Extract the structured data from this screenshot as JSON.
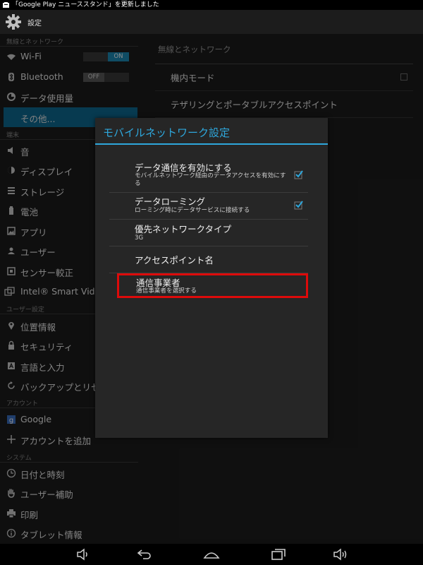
{
  "status_bar": {
    "notification": "「Google Play ニューススタンド」を更新しました"
  },
  "action_bar": {
    "title": "設定"
  },
  "sidebar": {
    "sections": [
      {
        "header": "無線とネットワーク"
      },
      {
        "header": "端末"
      },
      {
        "header": "ユーザー設定"
      },
      {
        "header": "アカウント"
      },
      {
        "header": "システム"
      }
    ],
    "items": [
      {
        "label": "Wi-Fi",
        "icon": "wifi-icon",
        "toggle": "ON"
      },
      {
        "label": "Bluetooth",
        "icon": "bluetooth-icon",
        "toggle": "OFF"
      },
      {
        "label": "データ使用量",
        "icon": "data-usage-icon"
      },
      {
        "label": "その他...",
        "icon": ""
      },
      {
        "label": "音",
        "icon": "sound-icon"
      },
      {
        "label": "ディスプレイ",
        "icon": "display-icon"
      },
      {
        "label": "ストレージ",
        "icon": "storage-icon"
      },
      {
        "label": "電池",
        "icon": "battery-icon"
      },
      {
        "label": "アプリ",
        "icon": "apps-icon"
      },
      {
        "label": "ユーザー",
        "icon": "user-icon"
      },
      {
        "label": "センサー較正",
        "icon": "sensor-icon"
      },
      {
        "label": "Intel® Smart Video",
        "icon": "intel-smart-video-icon"
      },
      {
        "label": "位置情報",
        "icon": "location-icon"
      },
      {
        "label": "セキュリティ",
        "icon": "lock-icon"
      },
      {
        "label": "言語と入力",
        "icon": "language-icon"
      },
      {
        "label": "バックアップとリセ",
        "icon": "backup-icon"
      },
      {
        "label": "Google",
        "icon": "google-icon"
      },
      {
        "label": "アカウントを追加",
        "icon": "add-icon"
      },
      {
        "label": "日付と時刻",
        "icon": "clock-icon"
      },
      {
        "label": "ユーザー補助",
        "icon": "accessibility-icon"
      },
      {
        "label": "印刷",
        "icon": "print-icon"
      },
      {
        "label": "タブレット情報",
        "icon": "info-icon"
      }
    ]
  },
  "main": {
    "header": "無線とネットワーク",
    "items": [
      {
        "label": "機内モード"
      },
      {
        "label": "テザリングとポータブルアクセスポイント"
      }
    ]
  },
  "dialog": {
    "title": "モバイルネットワーク設定",
    "options": [
      {
        "title": "データ通信を有効にする",
        "summary": "モバイルネットワーク経由のデータアクセスを有効にする",
        "checked": true
      },
      {
        "title": "データローミング",
        "summary": "ローミング時にデータサービスに接続する",
        "checked": true
      },
      {
        "title": "優先ネットワークタイプ",
        "summary": "3G"
      },
      {
        "title": "アクセスポイント名",
        "summary": ""
      },
      {
        "title": "通信事業者",
        "summary": "通信事業者を選択する"
      }
    ]
  },
  "colors": {
    "accent": "#2ea7dc",
    "selected_bg": "#0e6a92",
    "highlight_box": "#dd0a0a"
  }
}
